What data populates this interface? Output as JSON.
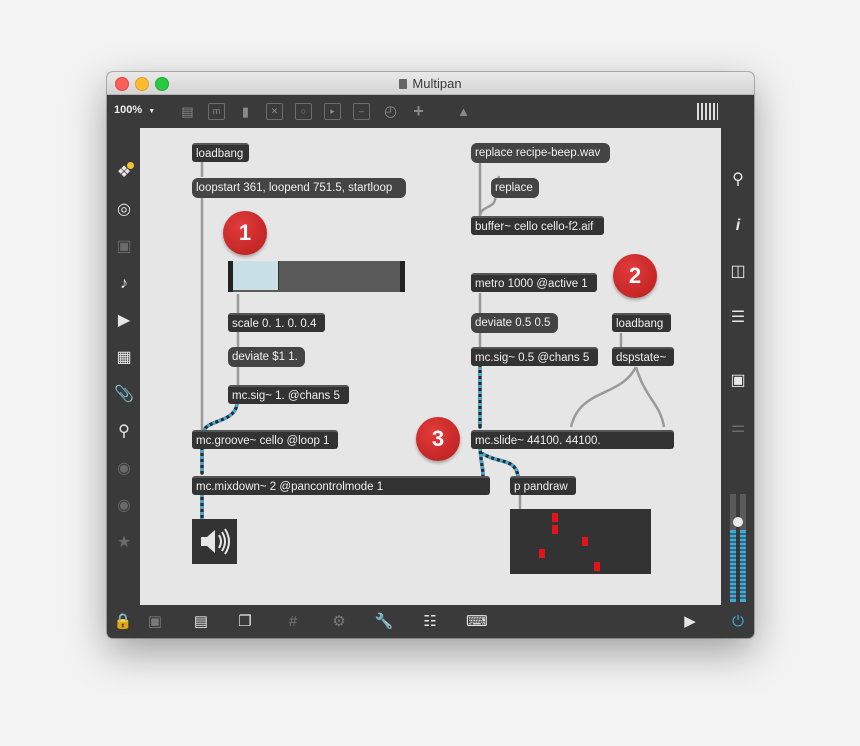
{
  "window": {
    "title": "Multipan"
  },
  "toolbar": {
    "zoom": "100%",
    "zoom_caret": "▼",
    "icons": [
      "object-box-icon",
      "message-box-icon",
      "comment-icon",
      "toggle-icon",
      "button-icon",
      "number-icon",
      "slider-icon",
      "dial-icon",
      "add-icon",
      "paint-bucket-icon"
    ]
  },
  "patch": {
    "loadbang_left": "loadbang",
    "loop_message": "loopstart 361, loopend 751.5, startloop",
    "scale": "scale 0. 1. 0. 0.4",
    "deviate_left": "deviate $1 1.",
    "mcsig_left": "mc.sig~ 1. @chans 5",
    "groove": "mc.groove~ cello @loop 1",
    "mixdown": "mc.mixdown~ 2 @pancontrolmode 1",
    "replace_file": "replace recipe-beep.wav",
    "replace": "replace",
    "buffer": "buffer~ cello cello-f2.aif",
    "metro": "metro 1000 @active 1",
    "deviate_right": "deviate 0.5 0.5",
    "mcsig_right": "mc.sig~ 0.5 @chans 5",
    "loadbang_right": "loadbang",
    "dspstate": "dspstate~",
    "slide": "mc.slide~ 44100. 44100.",
    "pandraw": "p pandraw"
  },
  "slider": {
    "value": 0.27
  },
  "badges": {
    "one": "1",
    "two": "2",
    "three": "3"
  },
  "colors": {
    "badge": "#cc2a2a",
    "mc_cable": "#3fa9d8",
    "pan_dot": "#e0141a",
    "meter": "#3fa9d8",
    "power": "#3fa9d8"
  }
}
